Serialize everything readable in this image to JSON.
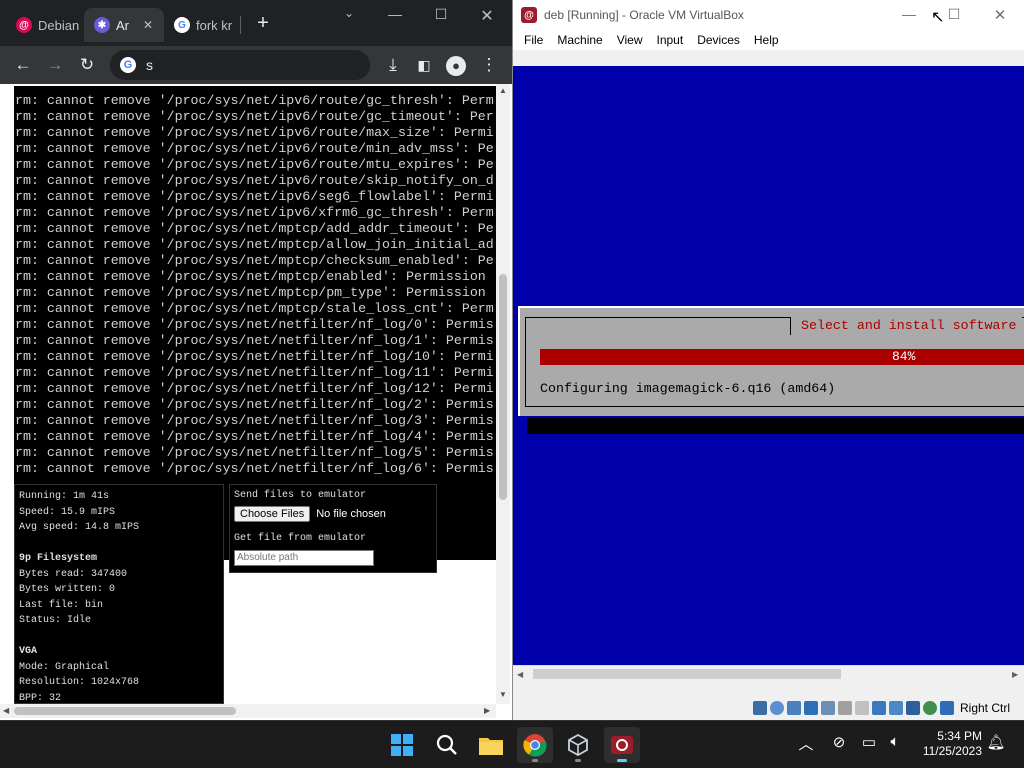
{
  "chrome": {
    "tabs": [
      {
        "label": "Debian",
        "favicon": "debian-swirl-icon"
      },
      {
        "label": "Ar",
        "favicon": "app-icon"
      },
      {
        "label": "fork kr",
        "favicon": "google-icon"
      }
    ],
    "new_tab": "+",
    "address": "s"
  },
  "terminal": {
    "lines": [
      "rm: cannot remove '/proc/sys/net/ipv6/route/gc_thresh': Perm",
      "rm: cannot remove '/proc/sys/net/ipv6/route/gc_timeout': Per",
      "rm: cannot remove '/proc/sys/net/ipv6/route/max_size': Permi",
      "rm: cannot remove '/proc/sys/net/ipv6/route/min_adv_mss': Pe",
      "rm: cannot remove '/proc/sys/net/ipv6/route/mtu_expires': Pe",
      "rm: cannot remove '/proc/sys/net/ipv6/route/skip_notify_on_d",
      "rm: cannot remove '/proc/sys/net/ipv6/seg6_flowlabel': Permi",
      "rm: cannot remove '/proc/sys/net/ipv6/xfrm6_gc_thresh': Perm",
      "rm: cannot remove '/proc/sys/net/mptcp/add_addr_timeout': Pe",
      "rm: cannot remove '/proc/sys/net/mptcp/allow_join_initial_ad",
      "rm: cannot remove '/proc/sys/net/mptcp/checksum_enabled': Pe",
      "rm: cannot remove '/proc/sys/net/mptcp/enabled': Permission",
      "rm: cannot remove '/proc/sys/net/mptcp/pm_type': Permission",
      "rm: cannot remove '/proc/sys/net/mptcp/stale_loss_cnt': Perm",
      "rm: cannot remove '/proc/sys/net/netfilter/nf_log/0': Permis",
      "rm: cannot remove '/proc/sys/net/netfilter/nf_log/1': Permis",
      "rm: cannot remove '/proc/sys/net/netfilter/nf_log/10': Permi",
      "rm: cannot remove '/proc/sys/net/netfilter/nf_log/11': Permi",
      "rm: cannot remove '/proc/sys/net/netfilter/nf_log/12': Permi",
      "rm: cannot remove '/proc/sys/net/netfilter/nf_log/2': Permis",
      "rm: cannot remove '/proc/sys/net/netfilter/nf_log/3': Permis",
      "rm: cannot remove '/proc/sys/net/netfilter/nf_log/4': Permis",
      "rm: cannot remove '/proc/sys/net/netfilter/nf_log/5': Permis",
      "rm: cannot remove '/proc/sys/net/netfilter/nf_log/6': Permis"
    ]
  },
  "stats": {
    "running": "Running: 1m 41s",
    "speed": "Speed: 15.9 mIPS",
    "avg_speed": "Avg speed: 14.8 mIPS",
    "fs_title": "9p Filesystem",
    "bytes_read": "Bytes read: 347400",
    "bytes_written": "Bytes written: 0",
    "last_file": "Last file: bin",
    "status": "Status: Idle",
    "vga_title": "VGA",
    "mode": "Mode: Graphical",
    "resolution": "Resolution: 1024x768",
    "bpp": "BPP: 32"
  },
  "files": {
    "send_label": "Send files to emulator",
    "choose_button": "Choose Files",
    "no_file": "No file chosen",
    "get_label": "Get file from emulator",
    "path_placeholder": "Absolute path"
  },
  "vbox": {
    "title": "deb [Running] - Oracle VM VirtualBox",
    "menu": [
      "File",
      "Machine",
      "View",
      "Input",
      "Devices",
      "Help"
    ],
    "dialog_title": "Select and install software",
    "progress_percent": 84,
    "progress_label": "84%",
    "status_text": "Configuring imagemagick-6.q16 (amd64)",
    "host_key": "Right Ctrl"
  },
  "taskbar": {
    "apps": [
      "windows-start-icon",
      "search-icon",
      "file-explorer-icon",
      "chrome-icon",
      "virtualbox-icon",
      "debian-app-icon"
    ],
    "time": "5:34 PM",
    "date": "11/25/2023"
  },
  "colors": {
    "vm_background": "#0000aa",
    "dialog_gray": "#aaaaaa",
    "dialog_title_red": "#aa0000",
    "progress_red": "#aa0000",
    "chrome_dark": "#202124",
    "taskbar": "#1c1c1c"
  }
}
